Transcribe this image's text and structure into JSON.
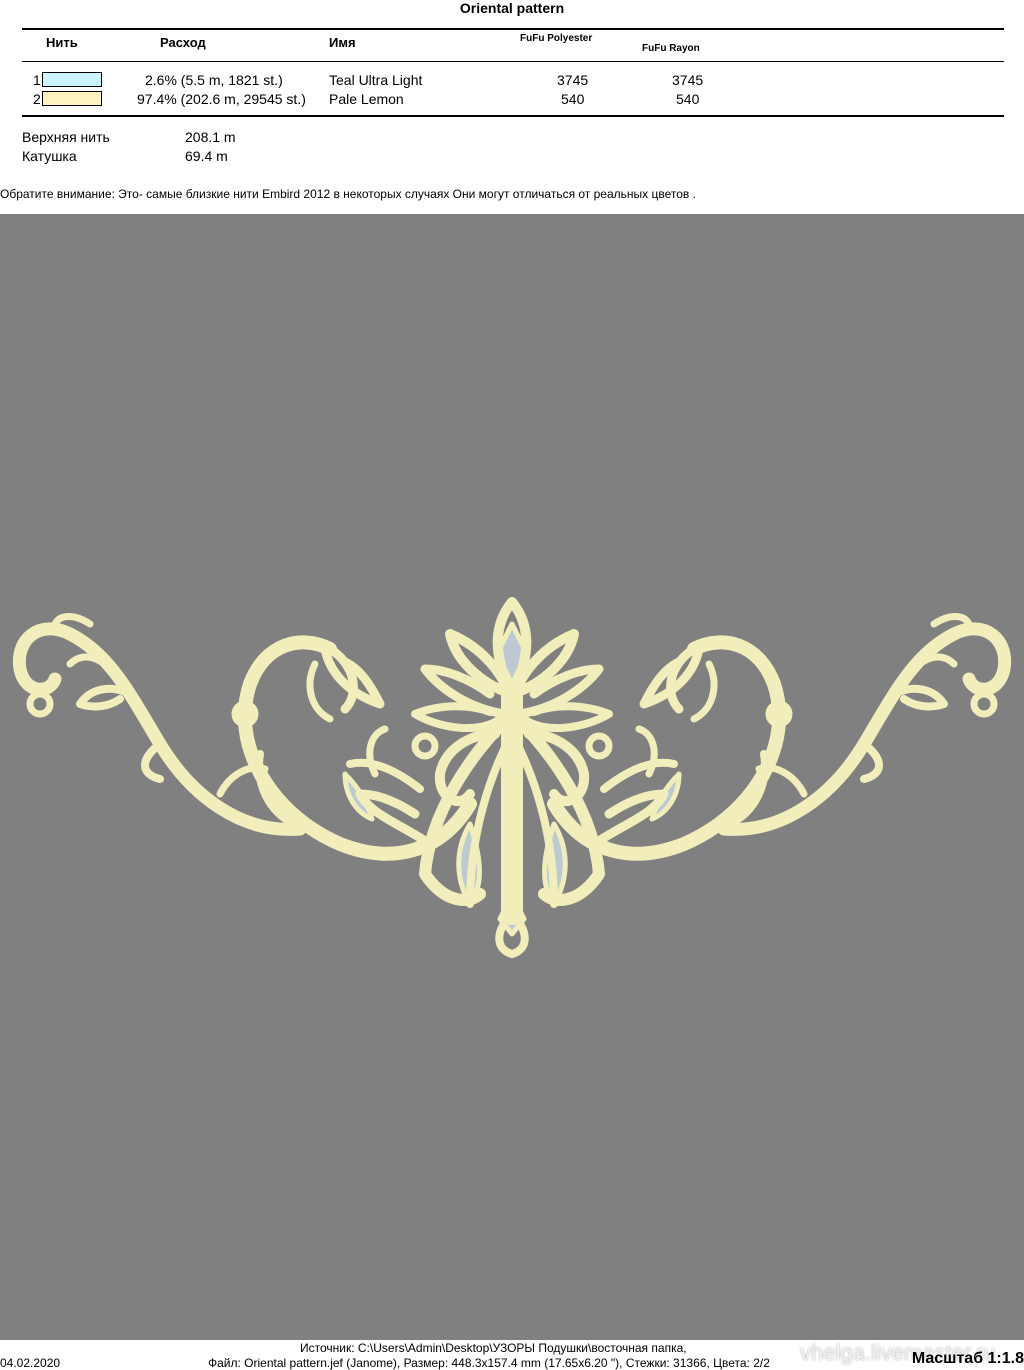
{
  "title": "Oriental pattern",
  "table": {
    "headers": {
      "thread": "Нить",
      "usage": "Расход",
      "name": "Имя",
      "brand1": "FuFu Polyester",
      "brand2": "FuFu Rayon"
    },
    "rows": [
      {
        "num": "1",
        "color": "#ccf4ff",
        "usage": "2.6% (5.5 m, 1821 st.)",
        "name": "Teal Ultra Light",
        "poly": "3745",
        "rayon": "3745"
      },
      {
        "num": "2",
        "color": "#fff3c4",
        "usage": "97.4% (202.6 m, 29545 st.)",
        "name": "Pale Lemon",
        "poly": "540",
        "rayon": "540"
      }
    ]
  },
  "totals": {
    "top_label": "Верхняя нить",
    "top_value": "208.1 m",
    "bobbin_label": "Катушка",
    "bobbin_value": "69.4 m"
  },
  "note": "Обратите внимание: Это- самые близкие нити Embird 2012 в некоторых случаях Они могут отличаться от реальных цветов .",
  "preview": {
    "background": "#808080",
    "thread_color": "#f2eebc",
    "fill_color": "#bcc9d2"
  },
  "footer": {
    "date": "04.02.2020",
    "source": "Источник: C:\\Users\\Admin\\Desktop\\УЗОРЫ Подушки\\восточная папка,",
    "file": "Файл: Oriental pattern.jef (Janome), Размер: 448.3x157.4 mm (17.65x6.20 \"), Стежки: 31366, Цвета: 2/2",
    "scale": "Масштаб 1:1.8",
    "watermark": "vhelga.livemaster.ru"
  }
}
